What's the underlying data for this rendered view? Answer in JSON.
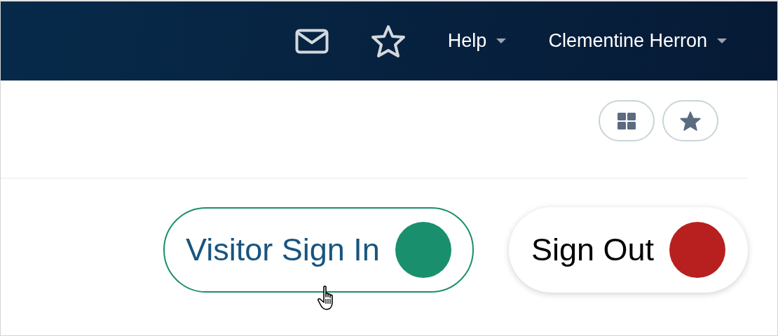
{
  "header": {
    "menus": [
      {
        "label": "Help"
      },
      {
        "label": "Clementine Herron"
      }
    ]
  },
  "actions": [
    {
      "label": "Visitor Sign In",
      "color": "#1a8f6e",
      "hovered": true
    },
    {
      "label": "Sign Out",
      "color": "#b82020",
      "hovered": false
    }
  ]
}
